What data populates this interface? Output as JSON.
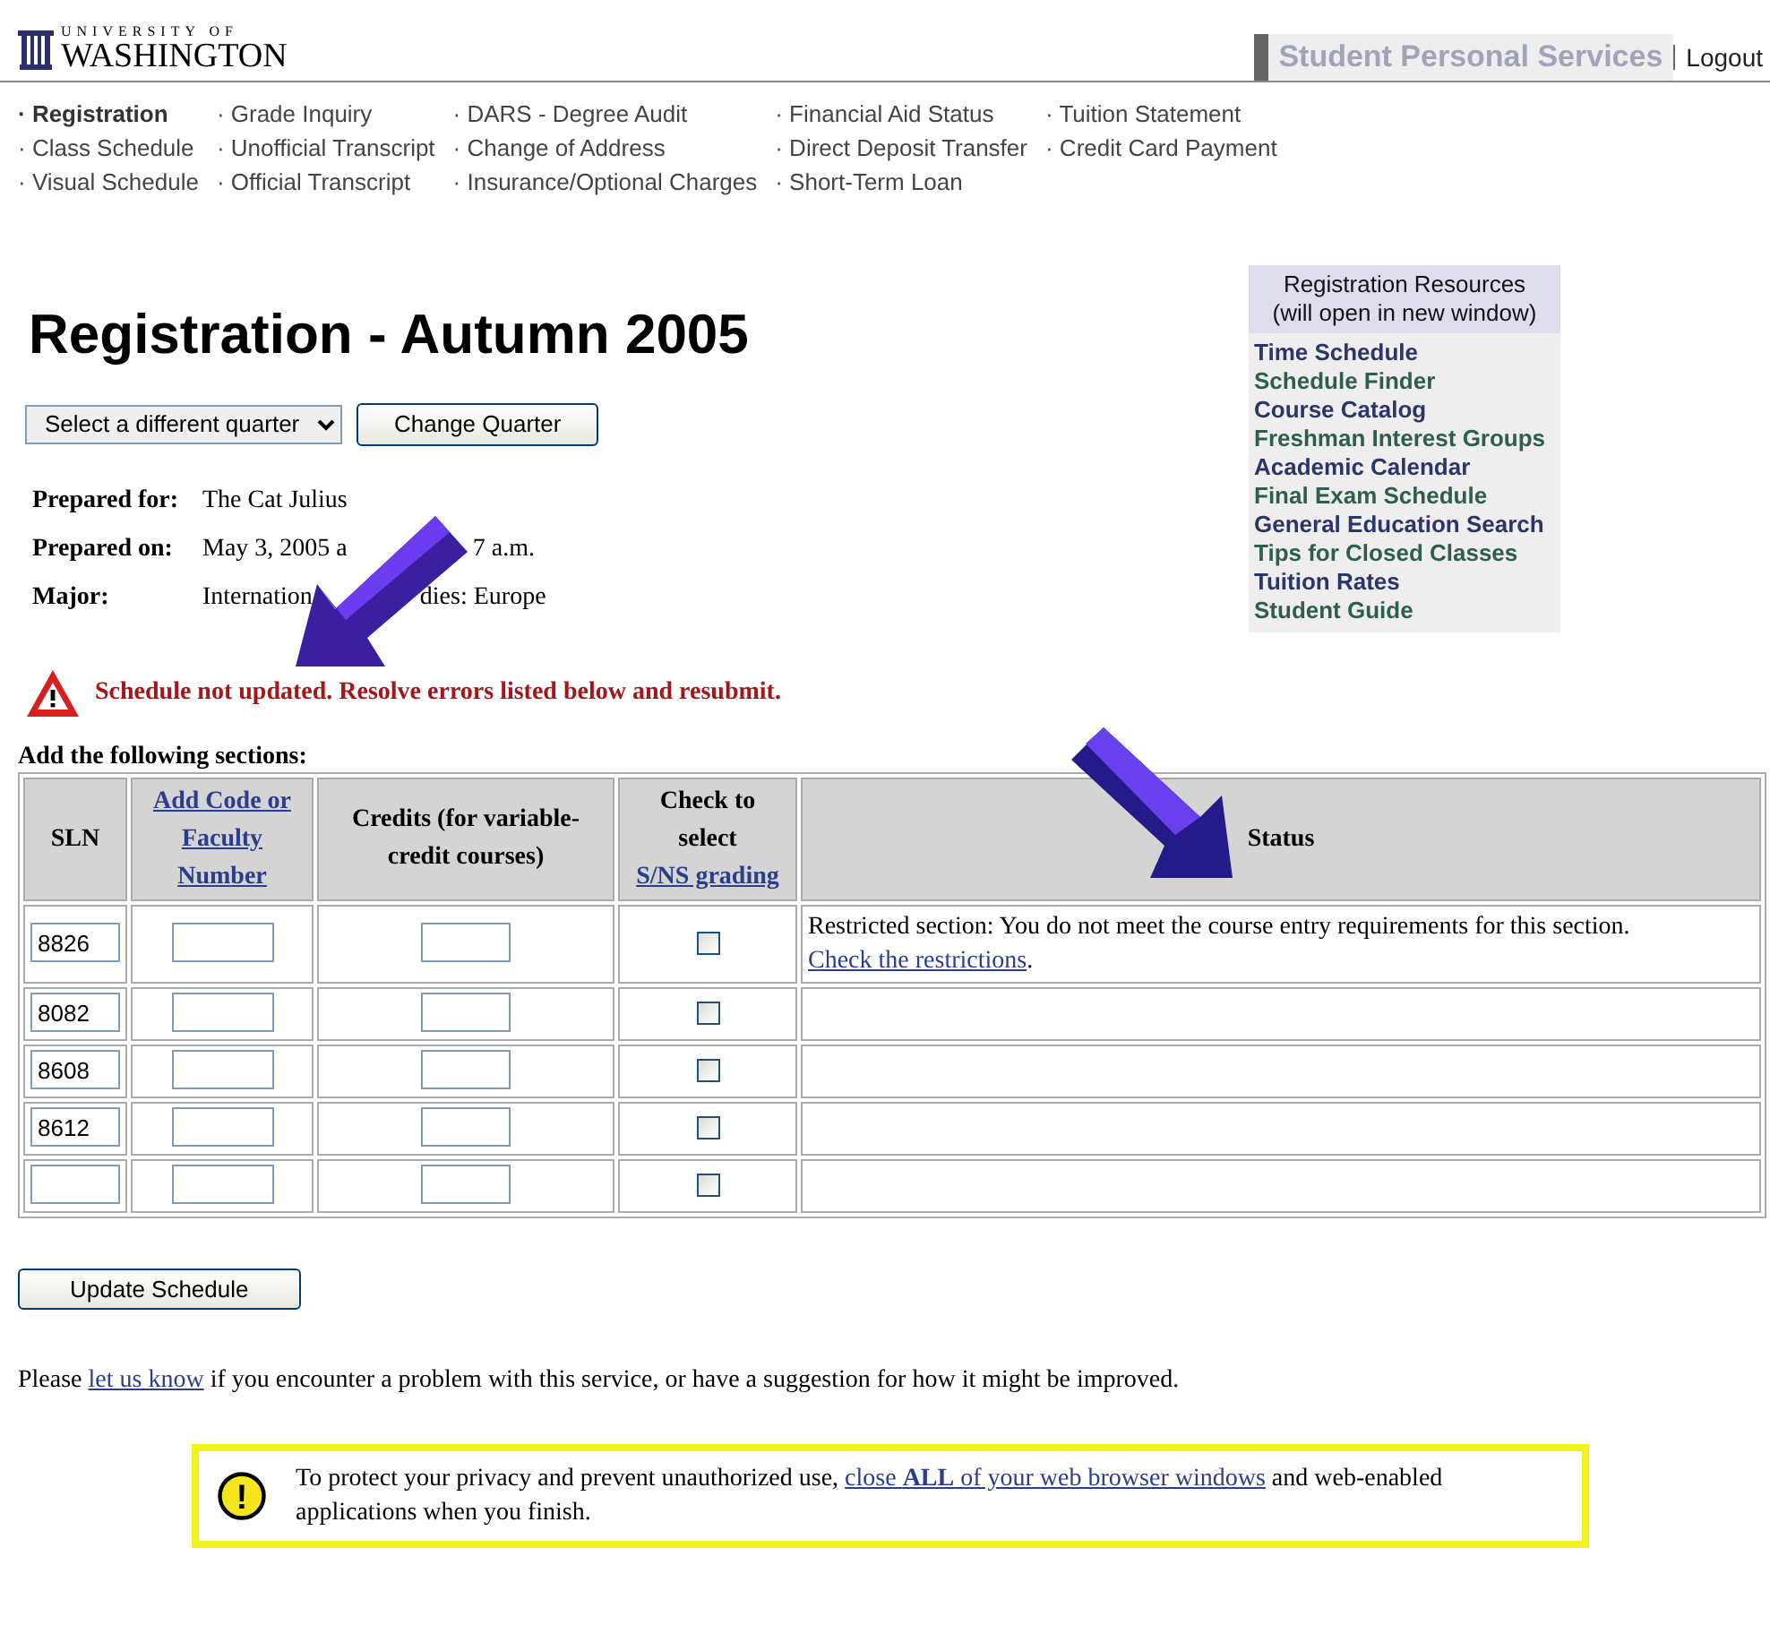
{
  "header": {
    "logo_small": "UNIVERSITY OF",
    "logo_large": "WASHINGTON",
    "service_title": "Student Personal Services",
    "logout": "Logout"
  },
  "nav_columns": [
    [
      {
        "label": "Registration",
        "selected": true
      },
      {
        "label": "Class Schedule",
        "selected": false
      },
      {
        "label": "Visual Schedule",
        "selected": false
      }
    ],
    [
      {
        "label": "Grade Inquiry",
        "selected": false
      },
      {
        "label": "Unofficial Transcript",
        "selected": false
      },
      {
        "label": "Official Transcript",
        "selected": false
      }
    ],
    [
      {
        "label": "DARS - Degree Audit",
        "selected": false
      },
      {
        "label": "Change of Address",
        "selected": false
      },
      {
        "label": "Insurance/Optional Charges",
        "selected": false
      }
    ],
    [
      {
        "label": "Financial Aid Status",
        "selected": false
      },
      {
        "label": "Direct Deposit Transfer",
        "selected": false
      },
      {
        "label": "Short-Term Loan",
        "selected": false
      }
    ],
    [
      {
        "label": "Tuition Statement",
        "selected": false
      },
      {
        "label": "Credit Card Payment",
        "selected": false
      }
    ]
  ],
  "nav_bullet": "·",
  "page_title": "Registration - Autumn 2005",
  "quarter_select": {
    "value": "Select a different quarter"
  },
  "change_quarter_button": "Change Quarter",
  "info": [
    {
      "label": "Prepared for:",
      "value": [
        "The Cat Julius"
      ]
    },
    {
      "label": "Prepared on:",
      "value": [
        "May 3, 2005 a",
        "7 a.m."
      ]
    },
    {
      "label": "Major:",
      "value": [
        "Internation",
        "dies: Europe"
      ]
    }
  ],
  "error_message": "Schedule not updated. Resolve errors listed below and resubmit.",
  "resources": {
    "title": "Registration Resources",
    "subtitle": "(will open in new window)",
    "links": [
      "Time Schedule",
      "Schedule Finder",
      "Course Catalog",
      "Freshman Interest Groups",
      "Academic Calendar",
      "Final Exam Schedule",
      "General Education Search",
      "Tips for Closed Classes",
      "Tuition Rates",
      "Student Guide"
    ]
  },
  "table": {
    "caption": "Add the following sections:",
    "columns": [
      {
        "text": "SLN",
        "kind": "plain"
      },
      {
        "text": "Add Code or Faculty Number",
        "kind": "link"
      },
      {
        "text": "Credits (for variable-credit courses)",
        "kind": "plain"
      },
      {
        "text": "Check to select",
        "link": "S/NS grading",
        "kind": "mixed"
      },
      {
        "text": "Status",
        "kind": "plain"
      }
    ],
    "rows": [
      {
        "sln": "8826",
        "checked": false,
        "status": "Restricted section: You do not meet the course entry requirements for this section.",
        "status_link": "Check the restrictions",
        "status_tail": "."
      },
      {
        "sln": "8082",
        "checked": false
      },
      {
        "sln": "8608",
        "checked": false
      },
      {
        "sln": "8612",
        "checked": false
      },
      {
        "checked": false
      }
    ]
  },
  "update_button": "Update Schedule",
  "feedback": {
    "before": "Please ",
    "link": "let us know",
    "after": " if you encounter a problem with this service, or have a suggestion for how it might be improved."
  },
  "privacy": {
    "icon_text": "!",
    "before": "To protect your privacy and prevent unauthorized use, ",
    "link": "close **ALL** of your web browser windows",
    "after": " and web-enabled applications when you finish."
  }
}
